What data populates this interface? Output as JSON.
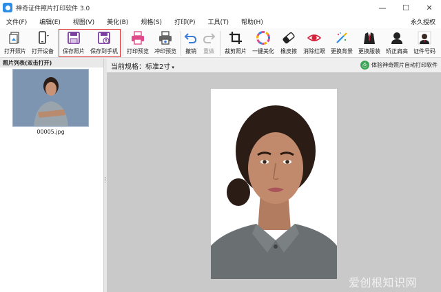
{
  "window": {
    "title": "神奇证件照片打印软件 3.0",
    "controls": [
      "—",
      "☐",
      "✕"
    ]
  },
  "menu": {
    "items": [
      "文件(F)",
      "编辑(E)",
      "视图(V)",
      "美化(B)",
      "规格(S)",
      "打印(P)",
      "工具(T)",
      "帮助(H)"
    ],
    "right": "永久授权"
  },
  "toolbar": {
    "buttons": [
      {
        "label": "打开照片",
        "icon": "open-photo-icon"
      },
      {
        "label": "打开设备",
        "icon": "open-device-icon"
      },
      {
        "label": "保存照片",
        "icon": "save-photo-icon"
      },
      {
        "label": "保存到手机",
        "icon": "save-to-phone-icon"
      },
      {
        "label": "打印预览",
        "icon": "print-preview-icon"
      },
      {
        "label": "冲印预览",
        "icon": "photo-print-preview-icon"
      },
      {
        "label": "撤销",
        "icon": "undo-icon"
      },
      {
        "label": "重做",
        "icon": "redo-icon"
      },
      {
        "label": "裁剪照片",
        "icon": "crop-icon"
      },
      {
        "label": "一键美化",
        "icon": "beautify-icon"
      },
      {
        "label": "橡皮擦",
        "icon": "eraser-icon"
      },
      {
        "label": "消除红眼",
        "icon": "red-eye-icon"
      },
      {
        "label": "更换背景",
        "icon": "change-background-icon"
      },
      {
        "label": "更换服装",
        "icon": "change-clothes-icon"
      },
      {
        "label": "矫正肩高",
        "icon": "shoulder-correct-icon"
      },
      {
        "label": "证件号码",
        "icon": "id-number-icon"
      }
    ],
    "highlight_color": "#e02b2b"
  },
  "left_panel": {
    "header": "照片列表(双击打开)",
    "thumbnails": [
      {
        "name": "00005.jpg"
      }
    ]
  },
  "main": {
    "spec_label": "当前规格：",
    "spec_value": "标准2寸",
    "spec_arrow": "▾",
    "promo": "体验神奇照片自动打印软件"
  },
  "watermark": "爱创根知识网",
  "colors": {
    "accent_blue": "#2a8ee8",
    "save_purple": "#7a3fa0",
    "print_pink": "#e04a8a",
    "undo_blue": "#3b7dd8",
    "red_eye": "#d8203a"
  }
}
